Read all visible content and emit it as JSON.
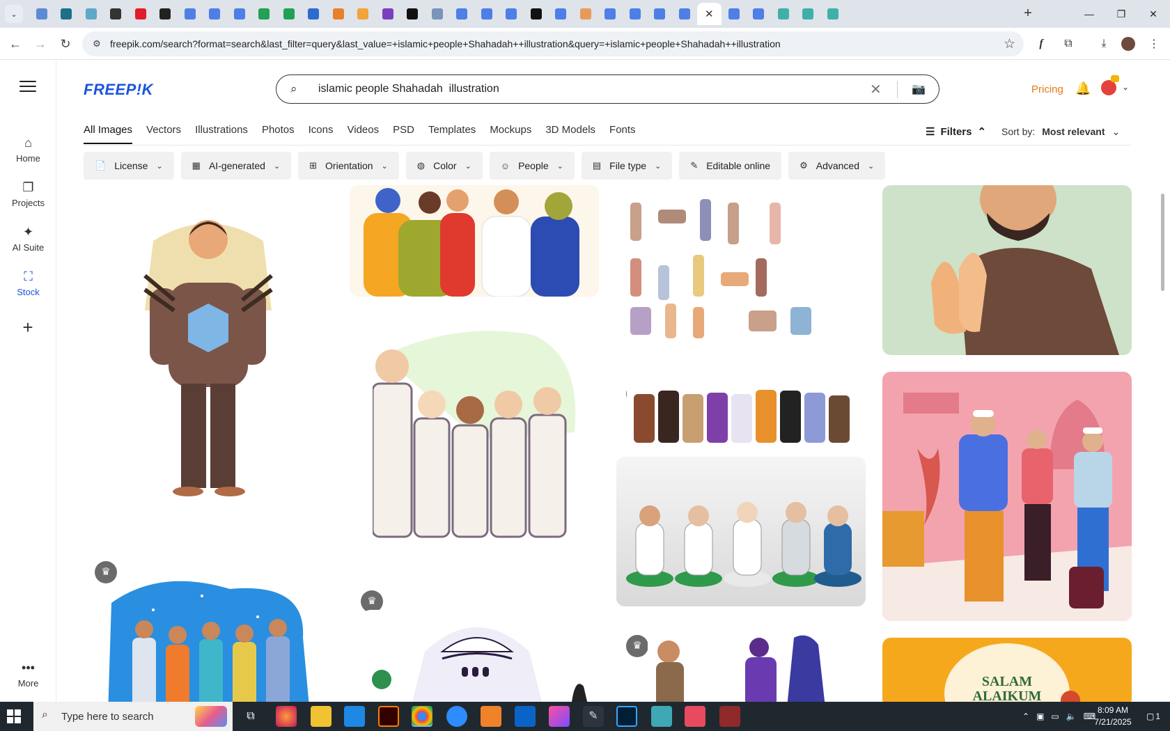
{
  "browser": {
    "tab_colors": [
      "#5b8bd6",
      "#1f6f8b",
      "#5fa9c8",
      "#333333",
      "#e11d2a",
      "#222222",
      "#4d7fe6",
      "#4d7fe6",
      "#4d7fe6",
      "#22a153",
      "#22a153",
      "#2e6bcf",
      "#e8802b",
      "#f2a33a",
      "#7a3fbf",
      "#111111",
      "#7a93b8",
      "#4d7fe6",
      "#4d7fe6",
      "#4d7fe6",
      "#111111",
      "#4d7fe6",
      "#e89a5a",
      "#4d7fe6",
      "#4d7fe6",
      "#4d7fe6",
      "#4d7fe6"
    ],
    "active_tab_close": "✕",
    "tabs_after_active": [
      "#4d7fe6",
      "#4d7fe6",
      "#3fb0a8",
      "#3fb0a8",
      "#3fb0a8"
    ],
    "url": "freepik.com/search?format=search&last_filter=query&last_value=+islamic+people+Shahadah++illustration&query=+islamic+people+Shahadah++illustration"
  },
  "freepik": {
    "logo": "FREEP!K",
    "search_value": "islamic people Shahadah  illustration",
    "pricing": "Pricing",
    "rail": [
      {
        "label": "Home",
        "icon": "⌂"
      },
      {
        "label": "Projects",
        "icon": "❐"
      },
      {
        "label": "AI Suite",
        "icon": "✦"
      },
      {
        "label": "Stock",
        "icon": "⛶"
      },
      {
        "label": "More",
        "icon": "•••"
      }
    ],
    "tabs": [
      "All Images",
      "Vectors",
      "Illustrations",
      "Photos",
      "Icons",
      "Videos",
      "PSD",
      "Templates",
      "Mockups",
      "3D Models",
      "Fonts"
    ],
    "filters_label": "Filters",
    "sort_label": "Sort by:",
    "sort_value": "Most relevant",
    "chips": [
      "License",
      "AI-generated",
      "Orientation",
      "Color",
      "People",
      "File type",
      "Editable online",
      "Advanced"
    ],
    "salam_text": "SALAM\nALAIKUM",
    "premium_badge": "♛"
  },
  "taskbar": {
    "search_placeholder": "Type here to search",
    "time": "8:09 AM",
    "date": "7/21/2025",
    "notification_count": "1"
  }
}
